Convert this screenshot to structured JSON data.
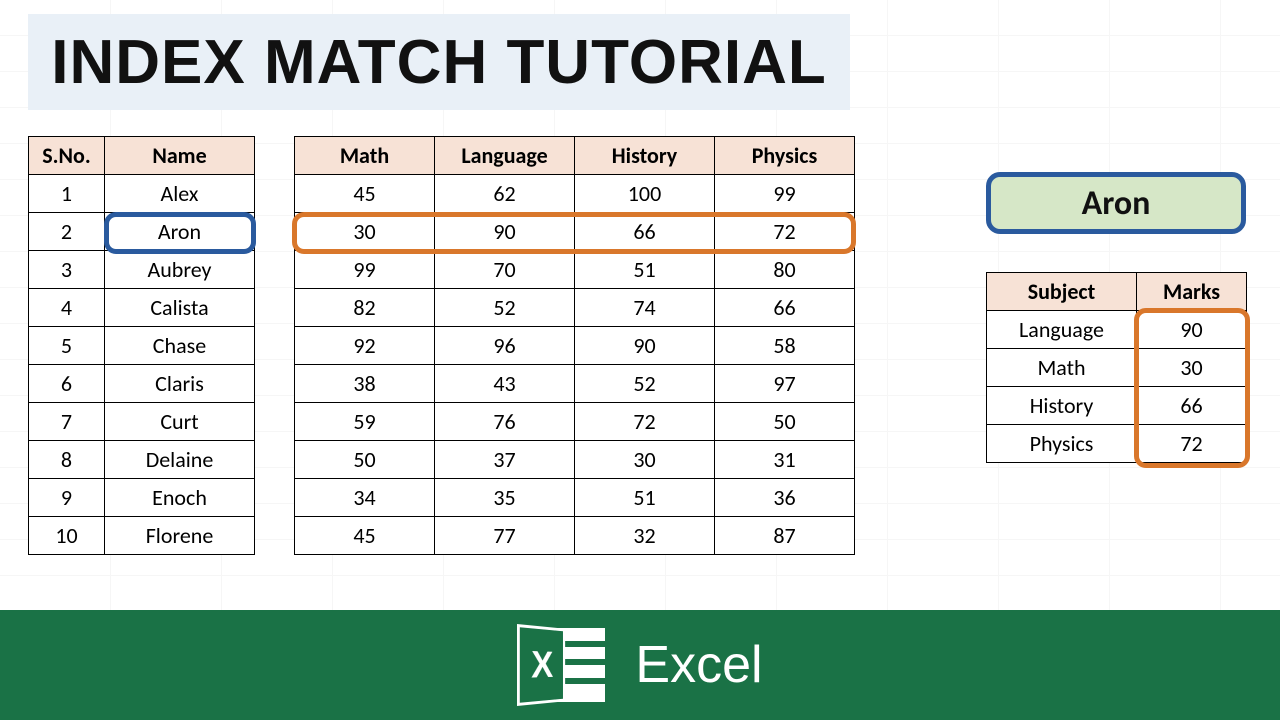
{
  "title": "INDEX MATCH TUTORIAL",
  "main_table": {
    "headers": {
      "sno": "S.No.",
      "name": "Name",
      "subjects": [
        "Math",
        "Language",
        "History",
        "Physics"
      ]
    },
    "rows": [
      {
        "sno": 1,
        "name": "Alex",
        "scores": [
          45,
          62,
          100,
          99
        ]
      },
      {
        "sno": 2,
        "name": "Aron",
        "scores": [
          30,
          90,
          66,
          72
        ]
      },
      {
        "sno": 3,
        "name": "Aubrey",
        "scores": [
          99,
          70,
          51,
          80
        ]
      },
      {
        "sno": 4,
        "name": "Calista",
        "scores": [
          82,
          52,
          74,
          66
        ]
      },
      {
        "sno": 5,
        "name": "Chase",
        "scores": [
          92,
          96,
          90,
          58
        ]
      },
      {
        "sno": 6,
        "name": "Claris",
        "scores": [
          38,
          43,
          52,
          97
        ]
      },
      {
        "sno": 7,
        "name": "Curt",
        "scores": [
          59,
          76,
          72,
          50
        ]
      },
      {
        "sno": 8,
        "name": "Delaine",
        "scores": [
          50,
          37,
          30,
          31
        ]
      },
      {
        "sno": 9,
        "name": "Enoch",
        "scores": [
          34,
          35,
          51,
          36
        ]
      },
      {
        "sno": 10,
        "name": "Florene",
        "scores": [
          45,
          77,
          32,
          87
        ]
      }
    ]
  },
  "lookup": {
    "selected_name": "Aron",
    "headers": {
      "subject": "Subject",
      "marks": "Marks"
    },
    "rows": [
      {
        "subject": "Language",
        "marks": 90
      },
      {
        "subject": "Math",
        "marks": 30
      },
      {
        "subject": "History",
        "marks": 66
      },
      {
        "subject": "Physics",
        "marks": 72
      }
    ]
  },
  "banner": {
    "app_name": "Excel",
    "icon_letter": "X"
  }
}
